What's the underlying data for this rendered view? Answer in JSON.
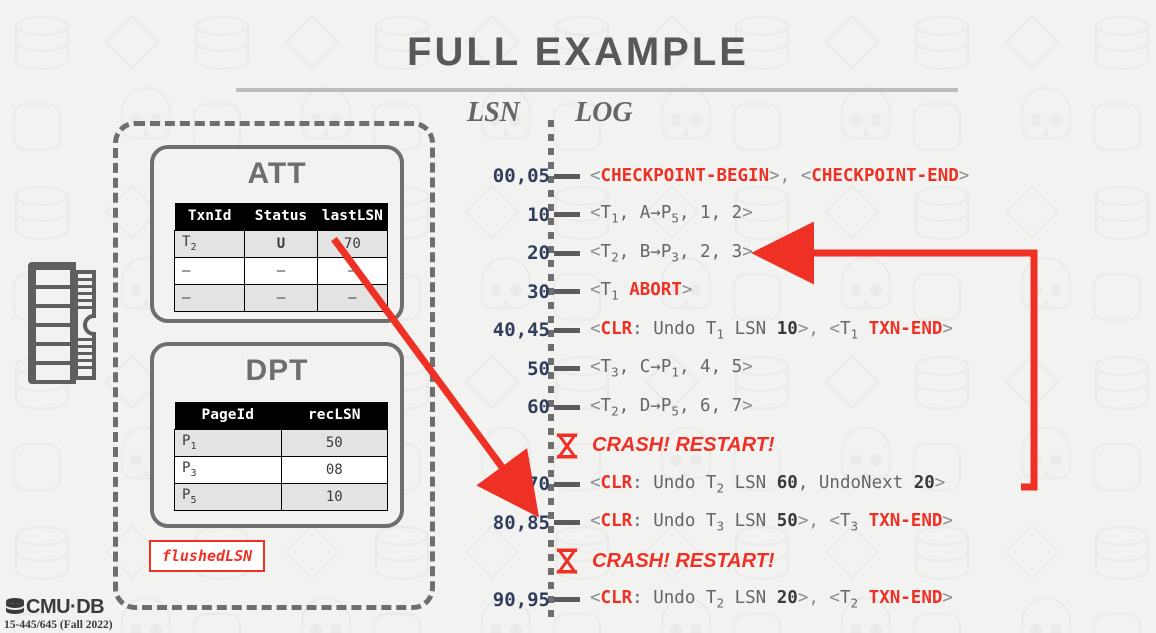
{
  "slide": {
    "title": "FULL EXAMPLE"
  },
  "memory": {
    "ram_icon": "memory-module-icon",
    "flushed_lsn_label": "flushedLSN"
  },
  "att": {
    "title": "ATT",
    "columns": [
      "TxnId",
      "Status",
      "lastLSN"
    ],
    "rows": [
      {
        "txn": "T",
        "txn_sub": "2",
        "status": "U",
        "last_lsn": "70"
      },
      {
        "txn": "–",
        "txn_sub": "",
        "status": "–",
        "last_lsn": "–"
      },
      {
        "txn": "–",
        "txn_sub": "",
        "status": "–",
        "last_lsn": "–"
      }
    ]
  },
  "dpt": {
    "title": "DPT",
    "columns": [
      "PageId",
      "recLSN"
    ],
    "rows": [
      {
        "page": "P",
        "page_sub": "1",
        "rec_lsn": "50"
      },
      {
        "page": "P",
        "page_sub": "3",
        "rec_lsn": "08"
      },
      {
        "page": "P",
        "page_sub": "5",
        "rec_lsn": "10"
      }
    ]
  },
  "log": {
    "header_lsn": "LSN",
    "header_log": "LOG",
    "entries": [
      {
        "type": "entry",
        "lsn": "00,05",
        "parts": [
          {
            "t": "<",
            "s": "br"
          },
          {
            "t": "CHECKPOINT-BEGIN",
            "s": "red"
          },
          {
            "t": ">, <",
            "s": "br"
          },
          {
            "t": "CHECKPOINT-END",
            "s": "red"
          },
          {
            "t": ">",
            "s": "br"
          }
        ]
      },
      {
        "type": "entry",
        "lsn": "10",
        "parts": [
          {
            "t": "<",
            "s": "br"
          },
          {
            "t": "T",
            "s": "plain"
          },
          {
            "t": "1",
            "s": "sub"
          },
          {
            "t": ", A→P",
            "s": "plain"
          },
          {
            "t": "5",
            "s": "sub"
          },
          {
            "t": ", 1, 2",
            "s": "plain"
          },
          {
            "t": ">",
            "s": "br"
          }
        ]
      },
      {
        "type": "entry",
        "lsn": "20",
        "parts": [
          {
            "t": "<",
            "s": "br"
          },
          {
            "t": "T",
            "s": "plain"
          },
          {
            "t": "2",
            "s": "sub"
          },
          {
            "t": ", B→P",
            "s": "plain"
          },
          {
            "t": "3",
            "s": "sub"
          },
          {
            "t": ", 2, 3",
            "s": "plain"
          },
          {
            "t": ">",
            "s": "br"
          }
        ]
      },
      {
        "type": "entry",
        "lsn": "30",
        "parts": [
          {
            "t": "<",
            "s": "br"
          },
          {
            "t": "T",
            "s": "plain"
          },
          {
            "t": "1",
            "s": "sub"
          },
          {
            "t": " ",
            "s": "plain"
          },
          {
            "t": "ABORT",
            "s": "red"
          },
          {
            "t": ">",
            "s": "br"
          }
        ]
      },
      {
        "type": "entry",
        "lsn": "40,45",
        "parts": [
          {
            "t": "<",
            "s": "br"
          },
          {
            "t": "CLR",
            "s": "red"
          },
          {
            "t": ": Undo T",
            "s": "plain"
          },
          {
            "t": "1",
            "s": "sub"
          },
          {
            "t": " LSN ",
            "s": "plain"
          },
          {
            "t": "10",
            "s": "blk"
          },
          {
            "t": ">, <",
            "s": "br"
          },
          {
            "t": "T",
            "s": "plain"
          },
          {
            "t": "1",
            "s": "sub"
          },
          {
            "t": " ",
            "s": "plain"
          },
          {
            "t": "TXN-END",
            "s": "red"
          },
          {
            "t": ">",
            "s": "br"
          }
        ]
      },
      {
        "type": "entry",
        "lsn": "50",
        "parts": [
          {
            "t": "<",
            "s": "br"
          },
          {
            "t": "T",
            "s": "plain"
          },
          {
            "t": "3",
            "s": "sub"
          },
          {
            "t": ", C→P",
            "s": "plain"
          },
          {
            "t": "1",
            "s": "sub"
          },
          {
            "t": ", 4, 5",
            "s": "plain"
          },
          {
            "t": ">",
            "s": "br"
          }
        ]
      },
      {
        "type": "entry",
        "lsn": "60",
        "parts": [
          {
            "t": "<",
            "s": "br"
          },
          {
            "t": "T",
            "s": "plain"
          },
          {
            "t": "2",
            "s": "sub"
          },
          {
            "t": ", D→P",
            "s": "plain"
          },
          {
            "t": "5",
            "s": "sub"
          },
          {
            "t": ", 6, 7",
            "s": "plain"
          },
          {
            "t": ">",
            "s": "br"
          }
        ]
      },
      {
        "type": "crash",
        "lsn": "",
        "text": "CRASH! RESTART!"
      },
      {
        "type": "entry",
        "lsn": "70",
        "parts": [
          {
            "t": "<",
            "s": "br"
          },
          {
            "t": "CLR",
            "s": "red"
          },
          {
            "t": ": Undo T",
            "s": "plain"
          },
          {
            "t": "2",
            "s": "sub"
          },
          {
            "t": " LSN ",
            "s": "plain"
          },
          {
            "t": "60",
            "s": "blk"
          },
          {
            "t": ", UndoNext ",
            "s": "plain"
          },
          {
            "t": "20",
            "s": "blk"
          },
          {
            "t": ">",
            "s": "br"
          }
        ]
      },
      {
        "type": "entry",
        "lsn": "80,85",
        "parts": [
          {
            "t": "<",
            "s": "br"
          },
          {
            "t": "CLR",
            "s": "red"
          },
          {
            "t": ": Undo T",
            "s": "plain"
          },
          {
            "t": "3",
            "s": "sub"
          },
          {
            "t": " LSN ",
            "s": "plain"
          },
          {
            "t": "50",
            "s": "blk"
          },
          {
            "t": ">, <",
            "s": "br"
          },
          {
            "t": "T",
            "s": "plain"
          },
          {
            "t": "3",
            "s": "sub"
          },
          {
            "t": " ",
            "s": "plain"
          },
          {
            "t": "TXN-END",
            "s": "red"
          },
          {
            "t": ">",
            "s": "br"
          }
        ]
      },
      {
        "type": "crash",
        "lsn": "",
        "text": "CRASH! RESTART!"
      },
      {
        "type": "entry",
        "lsn": "90,95",
        "parts": [
          {
            "t": "<",
            "s": "br"
          },
          {
            "t": "CLR",
            "s": "red"
          },
          {
            "t": ": Undo T",
            "s": "plain"
          },
          {
            "t": "2",
            "s": "sub"
          },
          {
            "t": " LSN ",
            "s": "plain"
          },
          {
            "t": "20",
            "s": "blk"
          },
          {
            "t": ">, <",
            "s": "br"
          },
          {
            "t": "T",
            "s": "plain"
          },
          {
            "t": "2",
            "s": "sub"
          },
          {
            "t": " ",
            "s": "plain"
          },
          {
            "t": "TXN-END",
            "s": "red"
          },
          {
            "t": ">",
            "s": "br"
          }
        ]
      }
    ]
  },
  "annotations": {
    "arrow_att_to_lsn70": "red-arrow",
    "arrow_undonext_to_lsn20": "red-arrow"
  },
  "footer": {
    "logo_text": "CMU·DB",
    "course": "15-445/645 (Fall 2022)"
  },
  "colors": {
    "accent_red": "#ee3124",
    "title_gray": "#58585a",
    "log_gray": "#63666a",
    "lsn_navy": "#303d5c",
    "background": "#f2f2f1"
  }
}
